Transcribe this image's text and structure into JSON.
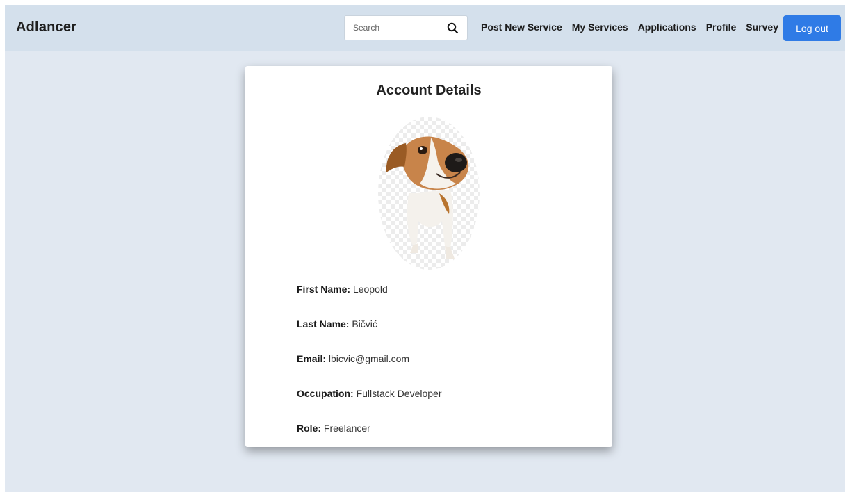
{
  "navbar": {
    "brand": "Adlancer",
    "search": {
      "placeholder": "Search",
      "value": "",
      "icon": "search-icon"
    },
    "links": [
      {
        "id": "post-new-service",
        "label": "Post New Service"
      },
      {
        "id": "my-services",
        "label": "My Services"
      },
      {
        "id": "applications",
        "label": "Applications"
      },
      {
        "id": "profile",
        "label": "Profile"
      },
      {
        "id": "survey",
        "label": "Survey"
      }
    ],
    "logout_label": "Log out",
    "accent_color": "#2f7be6"
  },
  "account": {
    "title": "Account Details",
    "avatar": "dog-profile-photo",
    "fields": [
      {
        "id": "first-name",
        "label": "First Name:",
        "value": "Leopold"
      },
      {
        "id": "last-name",
        "label": "Last Name:",
        "value": "Bičvić"
      },
      {
        "id": "email",
        "label": "Email:",
        "value": "lbicvic@gmail.com"
      },
      {
        "id": "occupation",
        "label": "Occupation:",
        "value": "Fullstack Developer"
      },
      {
        "id": "role",
        "label": "Role:",
        "value": "Freelancer"
      }
    ]
  }
}
